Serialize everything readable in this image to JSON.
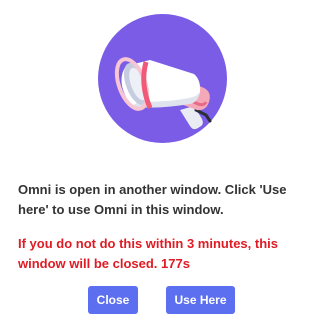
{
  "dialog": {
    "icon": "megaphone-icon",
    "message": "Omni is open in another window. Click 'Use here' to use Omni in this window.",
    "warning": "If you do not do this within 3 minutes, this window will be closed. 177s",
    "buttons": {
      "close_label": "Close",
      "use_here_label": "Use Here"
    }
  },
  "colors": {
    "circle": "#7a5ce6",
    "warning_text": "#e01b24",
    "button": "#5b6ff0",
    "body_text": "#333333"
  }
}
